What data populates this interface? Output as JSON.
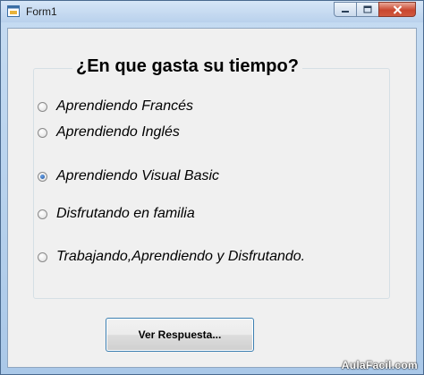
{
  "window": {
    "title": "Form1"
  },
  "group": {
    "title": "¿En que gasta su tiempo?"
  },
  "options": [
    {
      "label": "Aprendiendo Francés",
      "checked": false
    },
    {
      "label": "Aprendiendo Inglés",
      "checked": false
    },
    {
      "label": "Aprendiendo Visual Basic",
      "checked": true
    },
    {
      "label": "Disfrutando en familia",
      "checked": false
    },
    {
      "label": "Trabajando,Aprendiendo y Disfrutando.",
      "checked": false
    }
  ],
  "button": {
    "label": "Ver Respuesta..."
  },
  "watermark": {
    "text": "AulaFacil.com"
  },
  "icons": {
    "app": "form-window-icon",
    "minimize": "minimize-icon",
    "maximize": "maximize-icon",
    "close": "close-icon"
  }
}
